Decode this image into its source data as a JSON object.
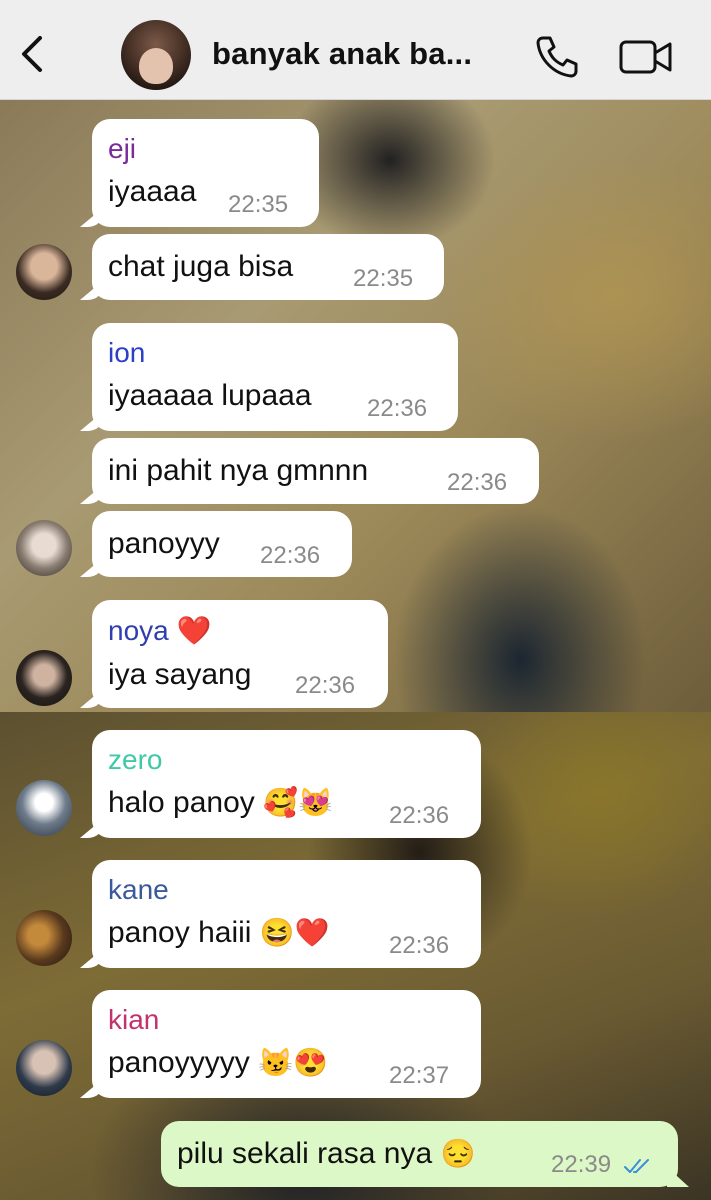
{
  "header": {
    "title": "banyak anak ba...",
    "back_icon": "chevron-left-icon",
    "call_icon": "phone-icon",
    "video_icon": "video-camera-icon"
  },
  "messages": [
    {
      "sender": "eji",
      "sender_color": "#7a2a9a",
      "text": "iyaaaa",
      "time": "22:35"
    },
    {
      "text": "chat juga bisa",
      "time": "22:35"
    },
    {
      "sender": "ion",
      "sender_color": "#2b3fc7",
      "text": "iyaaaaa lupaaa",
      "time": "22:36"
    },
    {
      "text": "ini pahit nya gmnnn",
      "time": "22:36"
    },
    {
      "text": "panoyyy",
      "time": "22:36"
    },
    {
      "sender": "noya",
      "sender_emoji": "❤️",
      "sender_color": "#2f3fae",
      "text": "iya sayang",
      "time": "22:36"
    },
    {
      "sender": "zero",
      "sender_color": "#3ec9a7",
      "text": "halo panoy",
      "text_emoji": "🥰😻",
      "time": "22:36"
    },
    {
      "sender": "kane",
      "sender_color": "#3a5a9a",
      "text": "panoy haiii",
      "text_emoji": "😆❤️",
      "time": "22:36"
    },
    {
      "sender": "kian",
      "sender_color": "#c2326e",
      "text": "panoyyyyy",
      "text_emoji": "😼😍",
      "time": "22:37"
    },
    {
      "text": "pilu sekali rasa nya",
      "text_emoji": "😔",
      "time": "22:39",
      "outgoing": true,
      "read_icon": "double-check-icon",
      "read_color": "#3a8fd9"
    }
  ]
}
